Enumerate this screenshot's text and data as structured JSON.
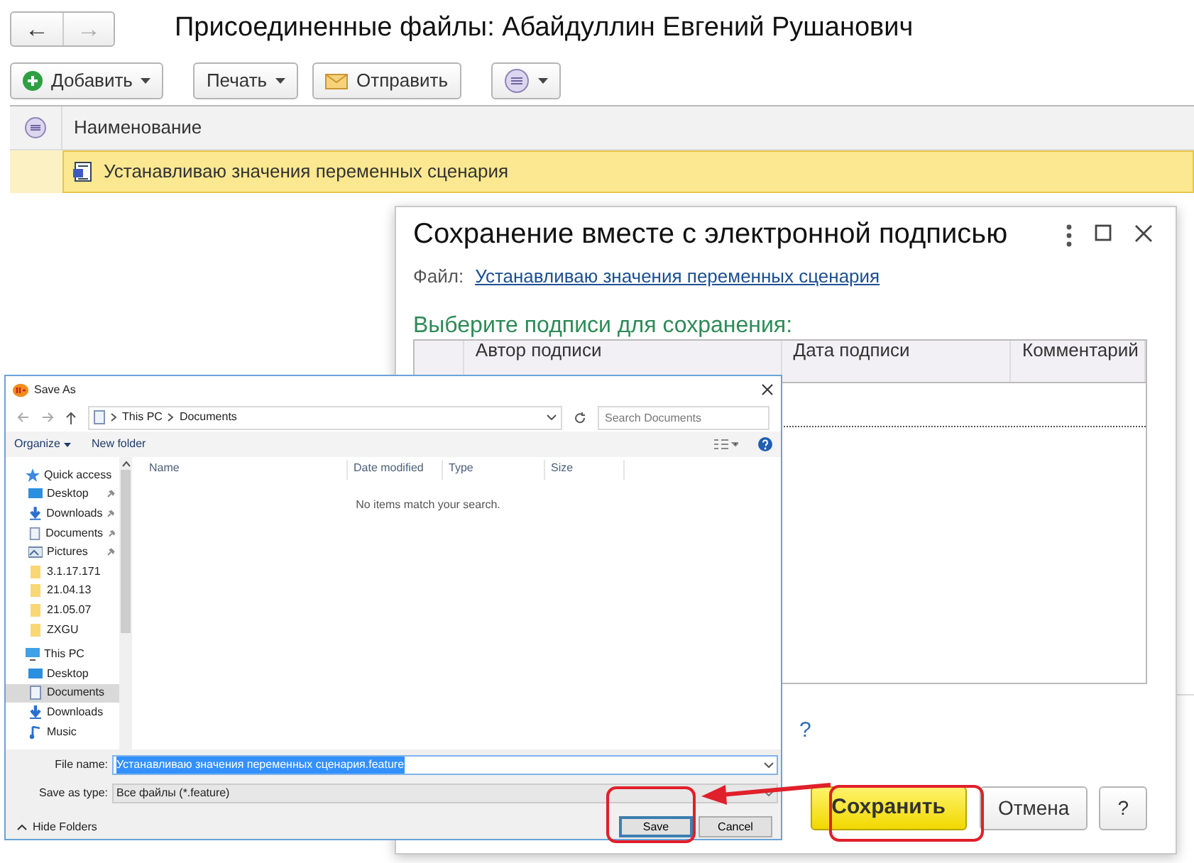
{
  "main": {
    "title": "Присоединенные файлы: Абайдуллин Евгений Рушанович",
    "nav": [
      {
        "label": "←",
        "disabled": false
      },
      {
        "label": "→",
        "disabled": true
      }
    ],
    "toolbar": [
      {
        "kind": "add",
        "label": "Добавить",
        "dropdown": true
      },
      {
        "kind": "plain",
        "label": "Печать",
        "dropdown": true
      },
      {
        "kind": "mail",
        "label": "Отправить",
        "dropdown": false
      },
      {
        "kind": "menu",
        "dropdown": true
      }
    ],
    "table": {
      "columns": [
        "Наименование"
      ],
      "rows": [
        {
          "name": "Устанавливаю значения переменных сценария",
          "selected": true
        }
      ]
    }
  },
  "sign_dialog": {
    "title": "Сохранение вместе с электронной подписью",
    "file_label": "Файл:",
    "file_link": "Устанавливаю значения переменных сценария",
    "section_title": "Выберите подписи для сохранения:",
    "columns": [
      "Автор подписи",
      "Дата подписи",
      "Комментарий"
    ],
    "help_link": "?",
    "buttons": [
      {
        "label": "Сохранить",
        "kind": "primary"
      },
      {
        "label": "Отмена",
        "kind": "plain"
      },
      {
        "label": "?",
        "kind": "plain"
      }
    ]
  },
  "save_as": {
    "title": "Save As",
    "path": [
      "This PC",
      "Documents"
    ],
    "search": {
      "placeholder": "Search Documents"
    },
    "toolbar": [
      {
        "label": "Organize",
        "dropdown": true
      },
      {
        "label": "New folder",
        "dropdown": false
      }
    ],
    "sidebar": [
      {
        "label": "Quick access",
        "kind": "star",
        "selected": false,
        "children": [
          {
            "label": "Desktop",
            "kind": "desktop",
            "pinned": true,
            "selected": false
          },
          {
            "label": "Downloads",
            "kind": "download",
            "pinned": true,
            "selected": false
          },
          {
            "label": "Documents",
            "kind": "document",
            "pinned": true,
            "selected": false
          },
          {
            "label": "Pictures",
            "kind": "pictures",
            "pinned": true,
            "selected": false
          },
          {
            "label": "3.1.17.171",
            "kind": "folder",
            "pinned": false,
            "selected": false
          },
          {
            "label": "21.04.13",
            "kind": "folder",
            "pinned": false,
            "selected": false
          },
          {
            "label": "21.05.07",
            "kind": "folder",
            "pinned": false,
            "selected": false
          },
          {
            "label": "ZXGU",
            "kind": "folder",
            "pinned": false,
            "selected": false
          }
        ]
      },
      {
        "label": "This PC",
        "kind": "pc",
        "selected": false,
        "children": [
          {
            "label": "Desktop",
            "kind": "desktop",
            "pinned": false,
            "selected": false
          },
          {
            "label": "Documents",
            "kind": "document",
            "pinned": false,
            "selected": true
          },
          {
            "label": "Downloads",
            "kind": "download",
            "pinned": false,
            "selected": false
          },
          {
            "label": "Music",
            "kind": "music",
            "pinned": false,
            "selected": false
          }
        ]
      }
    ],
    "columns": [
      "Name",
      "Date modified",
      "Type",
      "Size"
    ],
    "empty_text": "No items match your search.",
    "file_name_label": "File name:",
    "file_name": "Устанавливаю значения переменных сценария.feature",
    "type_label": "Save as type:",
    "type_value": "Все файлы (*.feature)",
    "hide_folders": "Hide Folders",
    "buttons": [
      {
        "label": "Save",
        "kind": "default"
      },
      {
        "label": "Cancel",
        "kind": "plain"
      }
    ]
  }
}
